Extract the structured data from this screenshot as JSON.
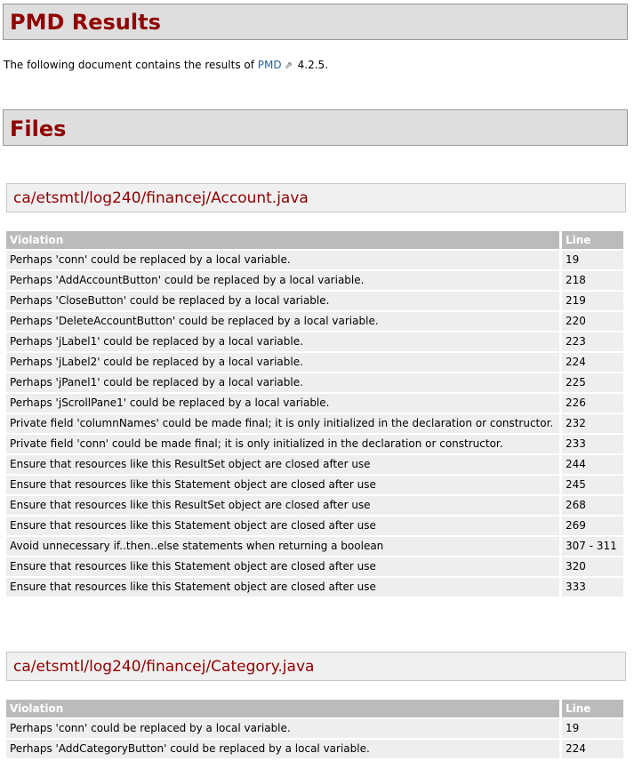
{
  "page_title": "PMD Results",
  "intro": {
    "prefix": "The following document contains the results of ",
    "link": "PMD",
    "suffix": " 4.2.5."
  },
  "files_heading": "Files",
  "columns": {
    "violation": "Violation",
    "line": "Line"
  },
  "files": [
    {
      "name": "ca/etsmtl/log240/financej/Account.java",
      "rows": [
        [
          "Perhaps 'conn' could be replaced by a local variable.",
          "19"
        ],
        [
          "Perhaps 'AddAccountButton' could be replaced by a local variable.",
          "218"
        ],
        [
          "Perhaps 'CloseButton' could be replaced by a local variable.",
          "219"
        ],
        [
          "Perhaps 'DeleteAccountButton' could be replaced by a local variable.",
          "220"
        ],
        [
          "Perhaps 'jLabel1' could be replaced by a local variable.",
          "223"
        ],
        [
          "Perhaps 'jLabel2' could be replaced by a local variable.",
          "224"
        ],
        [
          "Perhaps 'jPanel1' could be replaced by a local variable.",
          "225"
        ],
        [
          "Perhaps 'jScrollPane1' could be replaced by a local variable.",
          "226"
        ],
        [
          "Private field 'columnNames' could be made final; it is only initialized in the declaration or constructor.",
          "232"
        ],
        [
          "Private field 'conn' could be made final; it is only initialized in the declaration or constructor.",
          "233"
        ],
        [
          "Ensure that resources like this ResultSet object are closed after use",
          "244"
        ],
        [
          "Ensure that resources like this Statement object are closed after use",
          "245"
        ],
        [
          "Ensure that resources like this ResultSet object are closed after use",
          "268"
        ],
        [
          "Ensure that resources like this Statement object are closed after use",
          "269"
        ],
        [
          "Avoid unnecessary if..then..else statements when returning a boolean",
          "307 - 311"
        ],
        [
          "Ensure that resources like this Statement object are closed after use",
          "320"
        ],
        [
          "Ensure that resources like this Statement object are closed after use",
          "333"
        ]
      ]
    },
    {
      "name": "ca/etsmtl/log240/financej/Category.java",
      "rows": [
        [
          "Perhaps 'conn' could be replaced by a local variable.",
          "19"
        ],
        [
          "Perhaps 'AddCategoryButton' could be replaced by a local variable.",
          "224"
        ]
      ]
    }
  ],
  "colors": {
    "heading": "#900000",
    "link": "#2a6496",
    "header_row": "#bbbbbb",
    "row": "#eeeeee",
    "heading_box": "#dedede"
  }
}
